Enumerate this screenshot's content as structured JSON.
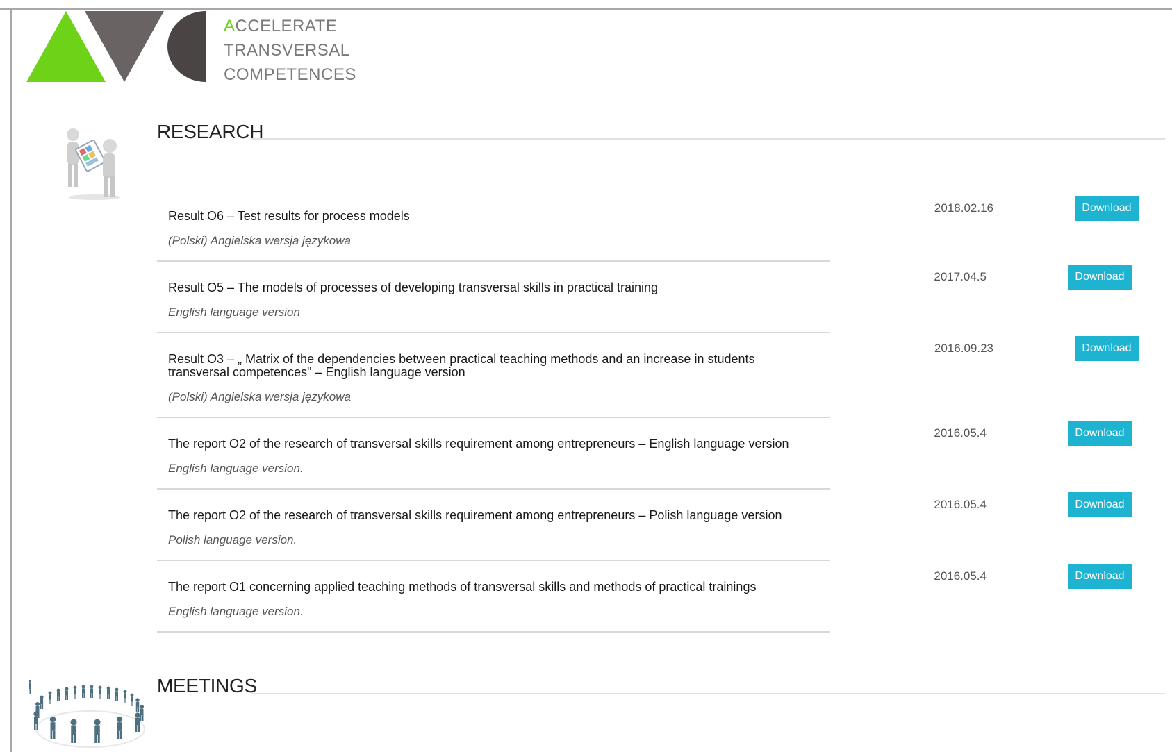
{
  "brand": {
    "line1_first": "A",
    "line1_rest": "CCELERATE",
    "line2": "TRANSVERSAL",
    "line3": "COMPETENCES",
    "accent_color": "#6ed318",
    "logo_shapes": [
      "green-triangle-icon",
      "gray-inverted-triangle-icon",
      "dark-half-circle-icon"
    ]
  },
  "research": {
    "title": "RESEARCH",
    "icon": "people-tablet-icon",
    "items": [
      {
        "title": "Result O6 – Test results for process models",
        "subtitle": "(Polski) Angielska wersja językowa",
        "date": "2018.02.16",
        "button": "Download"
      },
      {
        "title": "Result O5 – The models of processes of developing transversal skills in practical training",
        "subtitle": "English language version",
        "date": "2017.04.5",
        "button": "Download"
      },
      {
        "title": "Result O3 – „ Matrix of the dependencies between practical teaching methods and an increase in students transversal competences\" – English language version",
        "subtitle": "(Polski) Angielska wersja językowa",
        "date": "2016.09.23",
        "button": "Download"
      },
      {
        "title": "The report O2 of the research of transversal skills requirement among entrepreneurs – English language version",
        "subtitle": "English language version.",
        "date": "2016.05.4",
        "button": "Download"
      },
      {
        "title": "The report O2 of the research of transversal skills requirement among entrepreneurs – Polish language version",
        "subtitle": "Polish language version.",
        "date": "2016.05.4",
        "button": "Download"
      },
      {
        "title": "The report O1 concerning applied teaching methods of transversal skills and methods of practical trainings",
        "subtitle": "English language version.",
        "date": "2016.05.4",
        "button": "Download"
      }
    ]
  },
  "meetings": {
    "title": "MEETINGS",
    "icon": "people-circle-icon"
  },
  "colors": {
    "button": "#1fb3d2",
    "frame": "#a8a8a8"
  }
}
